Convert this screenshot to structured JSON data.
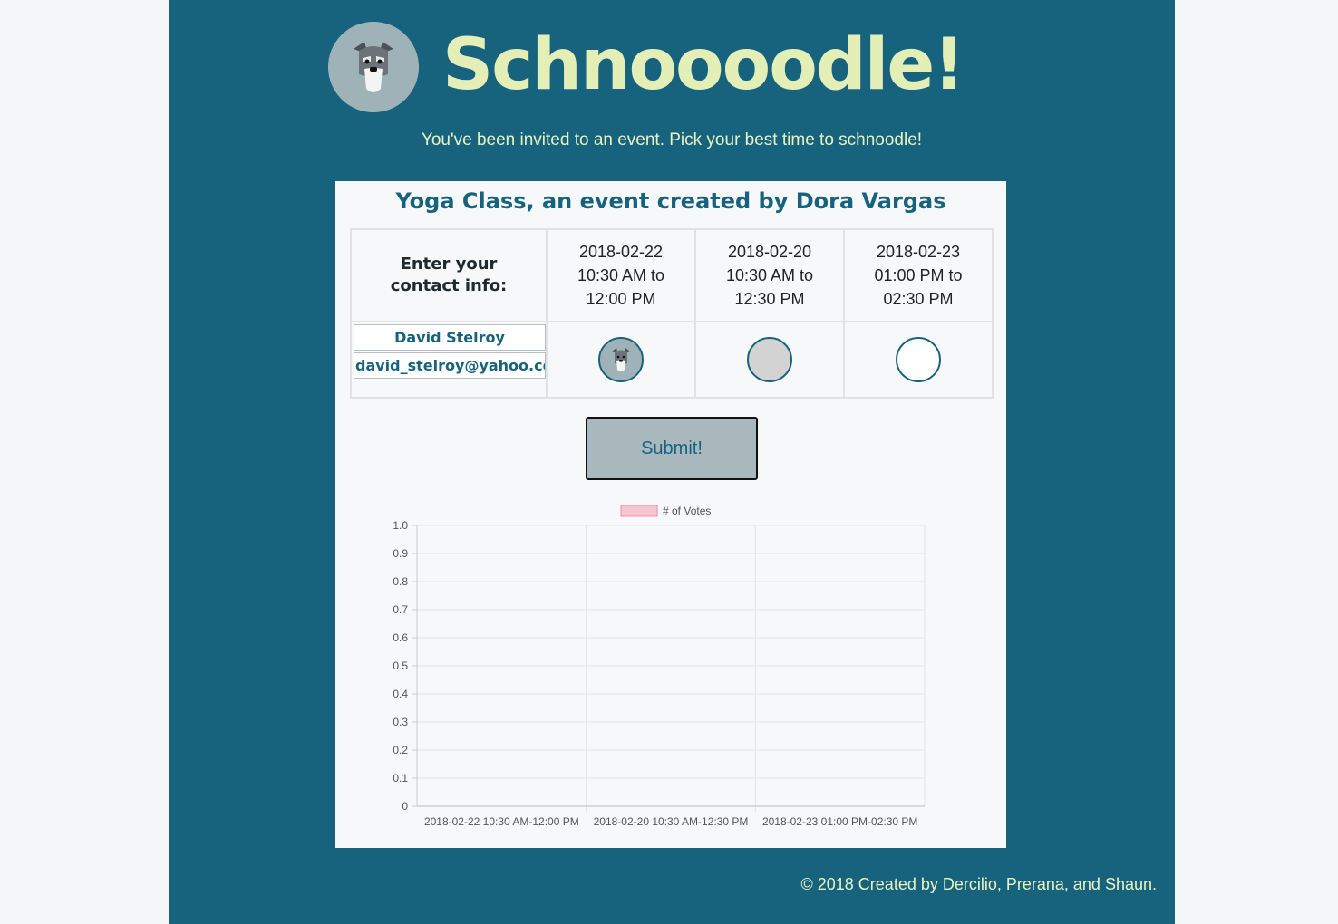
{
  "app": {
    "brand": "Schnoooodle!",
    "logo_icon": "schnauzer-dog-icon",
    "tagline": "You've been invited to an event. Pick your best time to schnoodle!"
  },
  "event": {
    "title": "Yoga Class, an event created by Dora Vargas",
    "contact_header": "Enter your contact info:",
    "slots": [
      {
        "date": "2018-02-22",
        "time": "10:30 AM to",
        "end": "12:00 PM",
        "state": "selected"
      },
      {
        "date": "2018-02-20",
        "time": "10:30 AM to",
        "end": "12:30 PM",
        "state": "maybe"
      },
      {
        "date": "2018-02-23",
        "time": "01:00 PM to",
        "end": "02:30 PM",
        "state": "empty"
      }
    ],
    "name_value": "David Stelroy",
    "email_value": "david_stelroy@yahoo.com",
    "submit_label": "Submit!"
  },
  "chart_data": {
    "type": "bar",
    "categories": [
      "2018-02-22 10:30 AM-12:00 PM",
      "2018-02-20 10:30 AM-12:30 PM",
      "2018-02-23 01:00 PM-02:30 PM"
    ],
    "series": [
      {
        "name": "# of Votes",
        "values": [
          0,
          0,
          0
        ]
      }
    ],
    "ylim": [
      0,
      1.0
    ],
    "yticks": [
      "1.0",
      "0.9",
      "0.8",
      "0.7",
      "0.6",
      "0.5",
      "0.4",
      "0.3",
      "0.2",
      "0.1",
      "0"
    ],
    "legend": "top-center",
    "grid": true,
    "legend_color": "#f7c6cf",
    "legend_border": "#f08ea2"
  },
  "footer": {
    "text": "© 2018 Created by Dercilio, Prerana, and Shaun."
  },
  "colors": {
    "page_bg": "#17637e",
    "brand": "#e4efb8",
    "card_bg": "#f7f8fa"
  }
}
